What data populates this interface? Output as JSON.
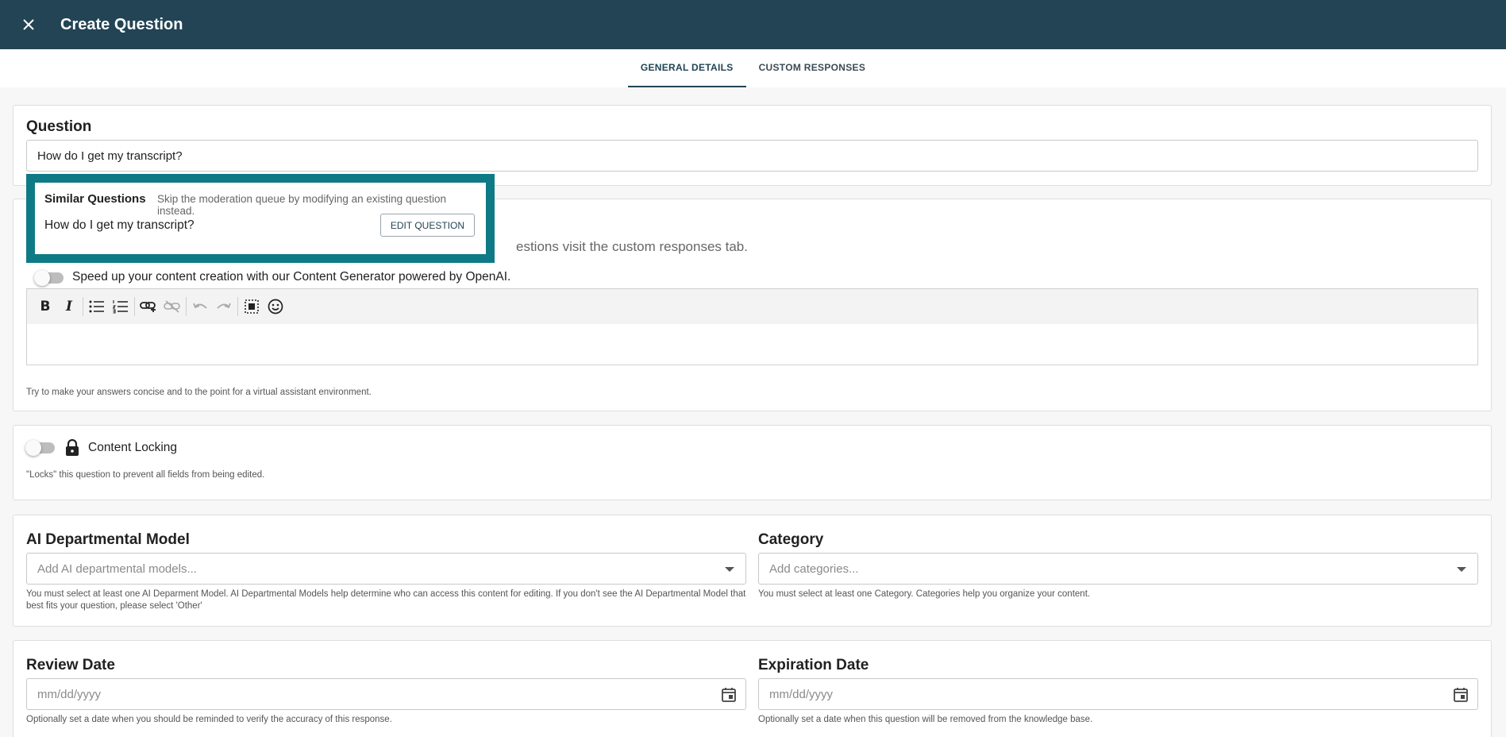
{
  "header": {
    "title": "Create Question"
  },
  "tabs": [
    {
      "label": "GENERAL DETAILS",
      "active": true
    },
    {
      "label": "CUSTOM RESPONSES",
      "active": false
    }
  ],
  "question": {
    "label": "Question",
    "value": "How do I get my transcript?"
  },
  "similar": {
    "title": "Similar Questions",
    "subtitle": "Skip the moderation queue by modifying an existing question instead.",
    "item": "How do I get my transcript?",
    "edit_label": "EDIT QUESTION"
  },
  "answer": {
    "partial_text": "estions visit the custom responses tab.",
    "generator_text": "Speed up your content creation with our Content Generator powered by OpenAI.",
    "helper": "Try to make your answers concise and to the point for a virtual assistant environment."
  },
  "locking": {
    "label": "Content Locking",
    "helper": "\"Locks\" this question to prevent all fields from being edited."
  },
  "ai_model": {
    "label": "AI Departmental Model",
    "placeholder": "Add AI departmental models...",
    "helper": "You must select at least one AI Deparment Model. AI Departmental Models help determine who can access this content for editing. If you don't see the AI Departmental Model that best fits your question, please select 'Other'"
  },
  "category": {
    "label": "Category",
    "placeholder": "Add categories...",
    "helper": "You must select at least one Category. Categories help you organize your content."
  },
  "review_date": {
    "label": "Review Date",
    "placeholder": "mm/dd/yyyy",
    "helper": "Optionally set a date when you should be reminded to verify the accuracy of this response."
  },
  "expiration_date": {
    "label": "Expiration Date",
    "placeholder": "mm/dd/yyyy",
    "helper": "Optionally set a date when this question will be removed from the knowledge base."
  },
  "colors": {
    "header_bg": "#224455",
    "highlight_border": "#0e7a85"
  }
}
